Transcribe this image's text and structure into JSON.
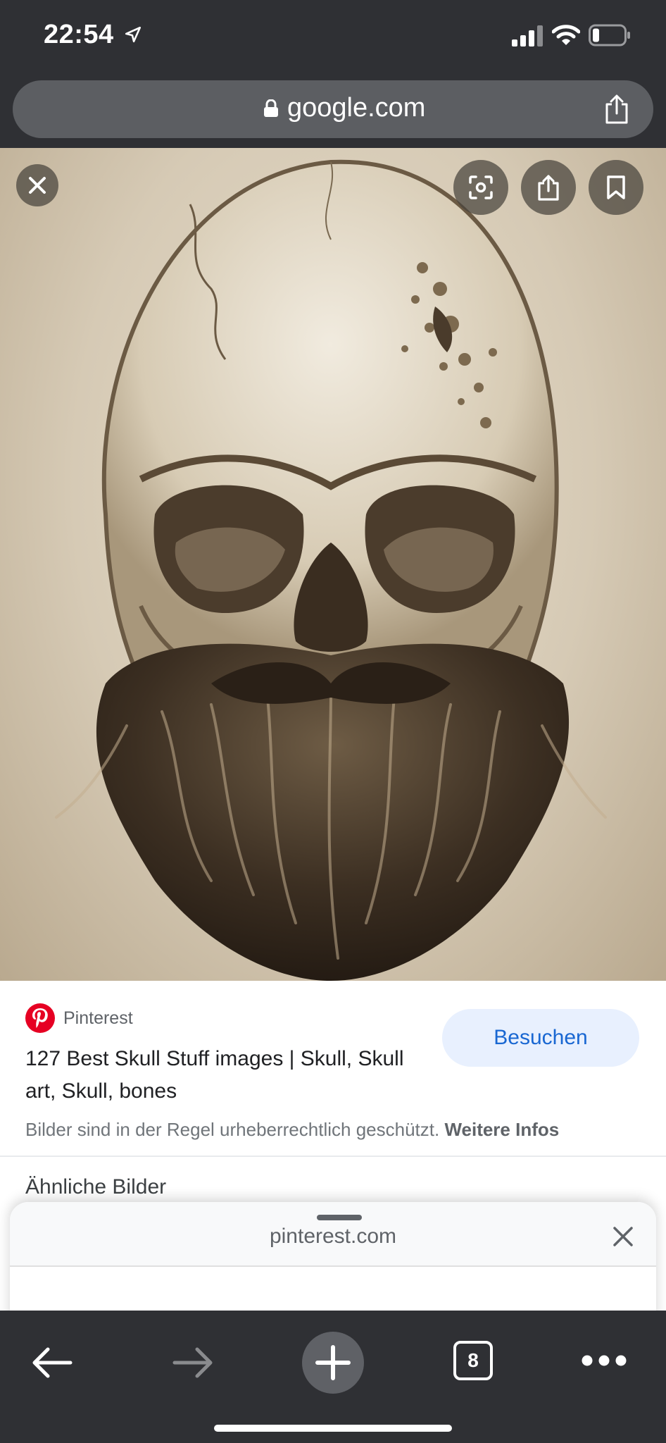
{
  "status_bar": {
    "time": "22:54",
    "icons": [
      "location-arrow-icon",
      "cellular-signal-icon",
      "wifi-icon",
      "battery-icon"
    ]
  },
  "url_bar": {
    "domain": "google.com",
    "icons": [
      "lock-icon",
      "share-icon"
    ]
  },
  "image_viewer": {
    "buttons": [
      "close-icon",
      "lens-icon",
      "share-icon",
      "bookmark-icon"
    ],
    "colors": {
      "button_bg": "#46423c",
      "paper": "#d6cab5"
    }
  },
  "result": {
    "source": "Pinterest",
    "title": "127 Best Skull Stuff images | Skull, Skull art, Skull, bones",
    "visit_label": "Besuchen",
    "copyright_text": "Bilder sind in der Regel urheberrechtlich geschützt.",
    "more_info_label": "Weitere Infos",
    "similar_heading": "Ähnliche Bilder"
  },
  "sheet": {
    "domain": "pinterest.com"
  },
  "toolbar": {
    "tab_count": "8",
    "icons": [
      "back-arrow-icon",
      "forward-arrow-icon",
      "plus-icon",
      "tabs-icon",
      "more-icon"
    ]
  },
  "colors": {
    "chrome_dark": "#2f3034",
    "urlbar": "#5c5e62",
    "visit_button_bg": "#e8f0fe",
    "visit_button_text": "#1967d2",
    "pinterest_red": "#e60023"
  }
}
